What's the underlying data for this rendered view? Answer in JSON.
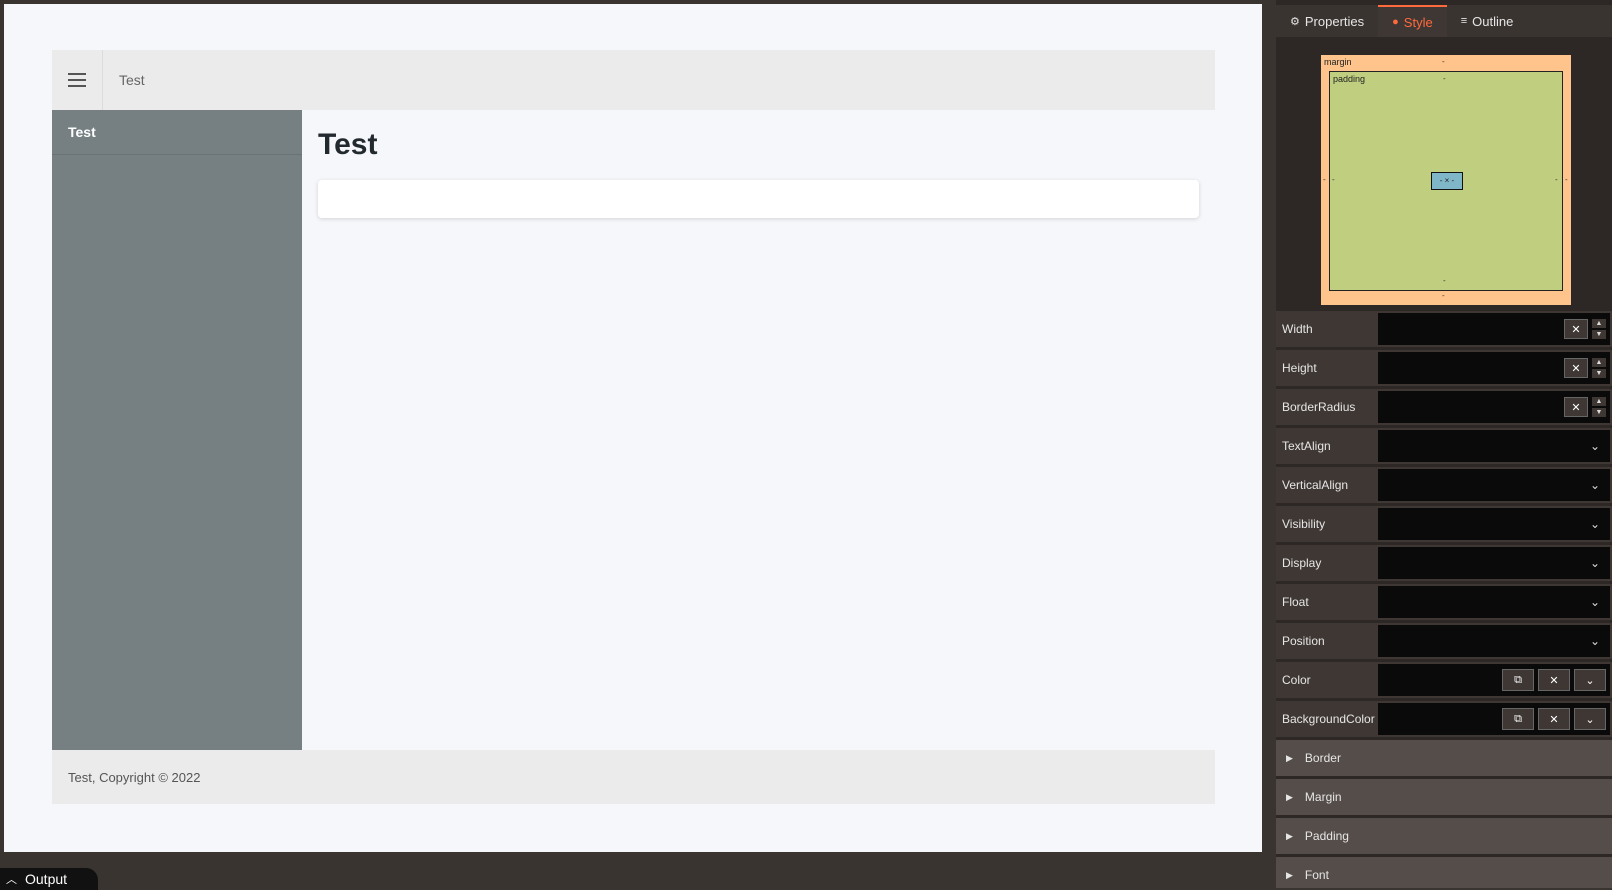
{
  "canvas": {
    "header_title": "Test",
    "sidebar_item": "Test",
    "main_title": "Test",
    "footer_text": "Test, Copyright © 2022"
  },
  "output_label": "Output",
  "tabs": [
    {
      "label": "Properties",
      "icon": "gear-icon"
    },
    {
      "label": "Style",
      "icon": "palette-icon",
      "active": true
    },
    {
      "label": "Outline",
      "icon": "list-icon"
    }
  ],
  "boxmodel": {
    "margin_label": "margin",
    "padding_label": "padding",
    "content_label": "- × -",
    "placeholder": "-"
  },
  "properties": [
    {
      "label": "Width",
      "type": "number"
    },
    {
      "label": "Height",
      "type": "number"
    },
    {
      "label": "BorderRadius",
      "type": "number"
    },
    {
      "label": "TextAlign",
      "type": "select"
    },
    {
      "label": "VerticalAlign",
      "type": "select"
    },
    {
      "label": "Visibility",
      "type": "select"
    },
    {
      "label": "Display",
      "type": "select"
    },
    {
      "label": "Float",
      "type": "select"
    },
    {
      "label": "Position",
      "type": "select"
    },
    {
      "label": "Color",
      "type": "color"
    },
    {
      "label": "BackgroundColor",
      "type": "color"
    }
  ],
  "sections": [
    "Border",
    "Margin",
    "Padding",
    "Font"
  ],
  "colors": {
    "accent": "#ff6a3d",
    "margin_box": "#ffc48b",
    "padding_box": "#bfcf7f",
    "content_box": "#7fb6c8",
    "sidebar": "#767f82"
  }
}
